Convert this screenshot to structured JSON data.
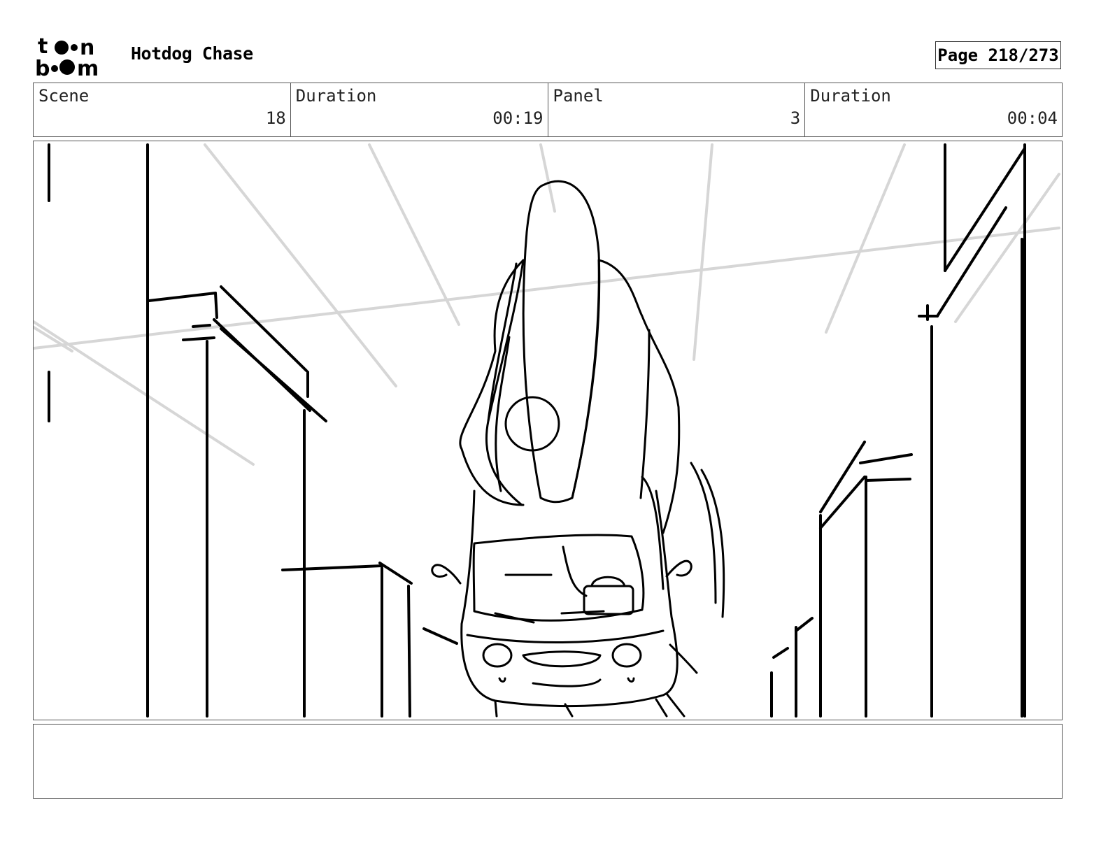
{
  "header": {
    "logo_text": "toon boom",
    "project_title": "Hotdog Chase",
    "page_label": "Page 218/273"
  },
  "info": [
    {
      "label": "Scene",
      "value": "18"
    },
    {
      "label": "Duration",
      "value": "00:19"
    },
    {
      "label": "Panel",
      "value": "3"
    },
    {
      "label": "Duration",
      "value": "00:04"
    }
  ],
  "panel": {
    "description_icon": "storyboard-sketch-hotdog-on-car-between-buildings"
  },
  "caption": {
    "text": ""
  }
}
